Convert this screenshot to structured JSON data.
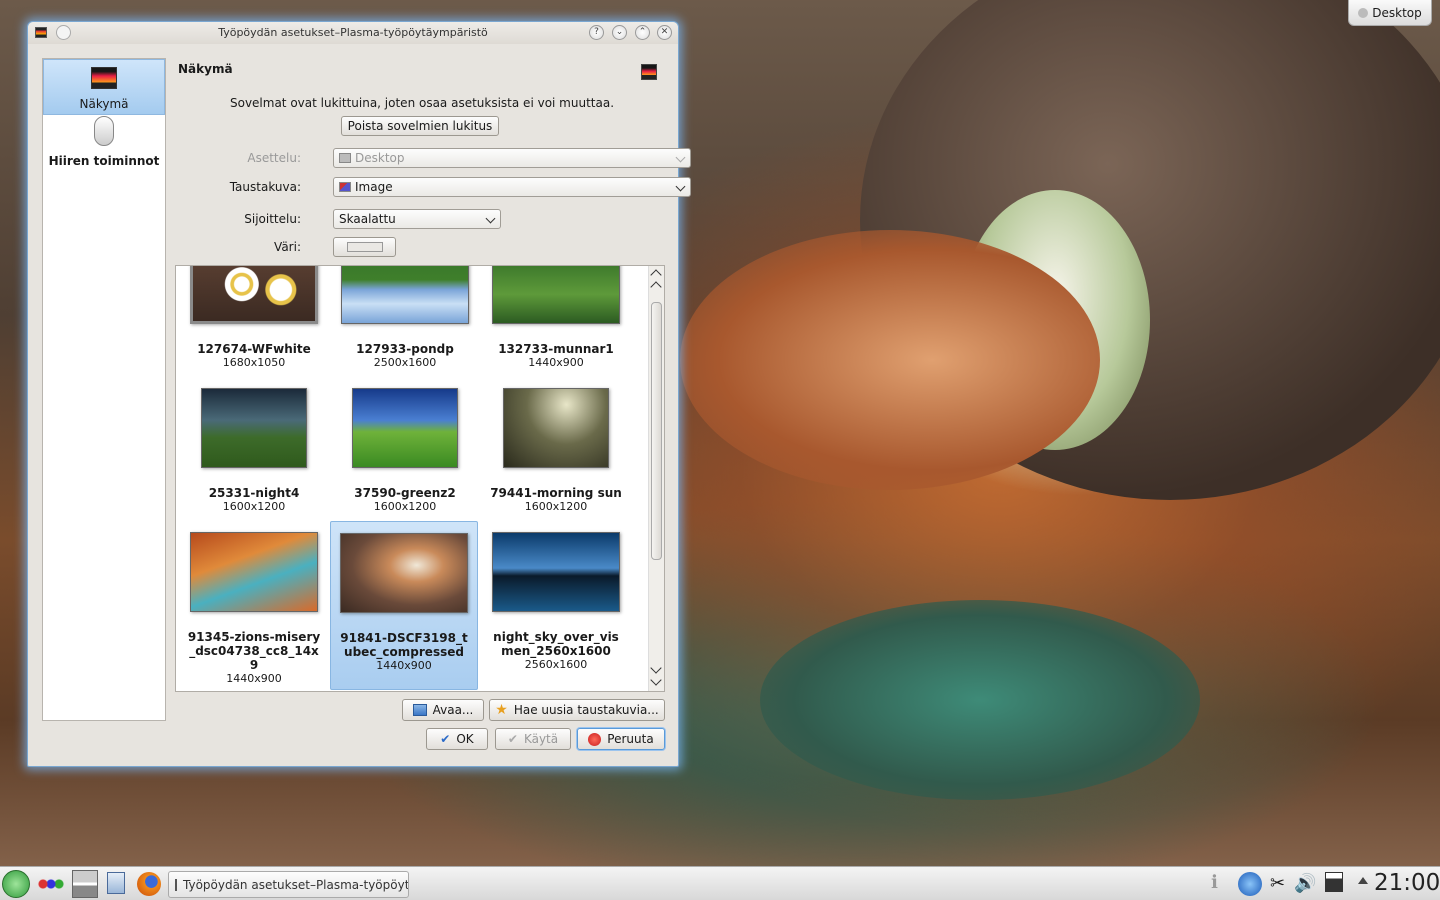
{
  "desktop": {
    "toolbox_label": "Desktop"
  },
  "window": {
    "title": "Työpöydän asetukset–Plasma-työpöytäympäristö",
    "help_glyph": "?",
    "minimize_glyph": "⌄",
    "maximize_glyph": "⌃",
    "close_glyph": "✕"
  },
  "sidebar": {
    "items": [
      {
        "label": "Näkymä",
        "icon": "display-icon",
        "selected": true
      },
      {
        "label": "Hiiren toiminnot",
        "icon": "mouse-icon",
        "selected": false
      }
    ]
  },
  "section": {
    "title": "Näkymä",
    "lock_message": "Sovelmat ovat lukittuina, joten osaa asetuksista ei voi muuttaa.",
    "unlock_button": "Poista sovelmien lukitus",
    "layout_label": "Asettelu:",
    "layout_value": "Desktop",
    "wallpaper_label": "Taustakuva:",
    "wallpaper_value": "Image",
    "positioning_label": "Sijoittelu:",
    "positioning_value": "Skaalattu",
    "color_label": "Väri:"
  },
  "wallpapers": [
    {
      "name": "127674-WFwhite",
      "res": "1680x1050"
    },
    {
      "name": "127933-pondp",
      "res": "2500x1600"
    },
    {
      "name": "132733-munnar1",
      "res": "1440x900"
    },
    {
      "name": "25331-night4",
      "res": "1600x1200"
    },
    {
      "name": "37590-greenz2",
      "res": "1600x1200"
    },
    {
      "name": "79441-morning sun",
      "res": "1600x1200"
    },
    {
      "name": "91345-zions-misery_dsc04738_cc8_14x9",
      "res": "1440x900"
    },
    {
      "name": "91841-DSCF3198_tubec_compressed",
      "res": "1440x900",
      "selected": true
    },
    {
      "name": "night_sky_over_vismen_2560x1600",
      "res": "2560x1600"
    }
  ],
  "buttons": {
    "open": "Avaa...",
    "get_new": "Hae uusia taustakuvia...",
    "ok": "OK",
    "apply": "Käytä",
    "cancel": "Peruuta"
  },
  "taskbar": {
    "task_label": "Työpöydän asetukset–Plasma-työpöytä",
    "clock": "21:00"
  },
  "colors": {
    "selection": "#a9cdf0",
    "window_bg": "#e7e4df",
    "glow": "#78b4f0"
  }
}
